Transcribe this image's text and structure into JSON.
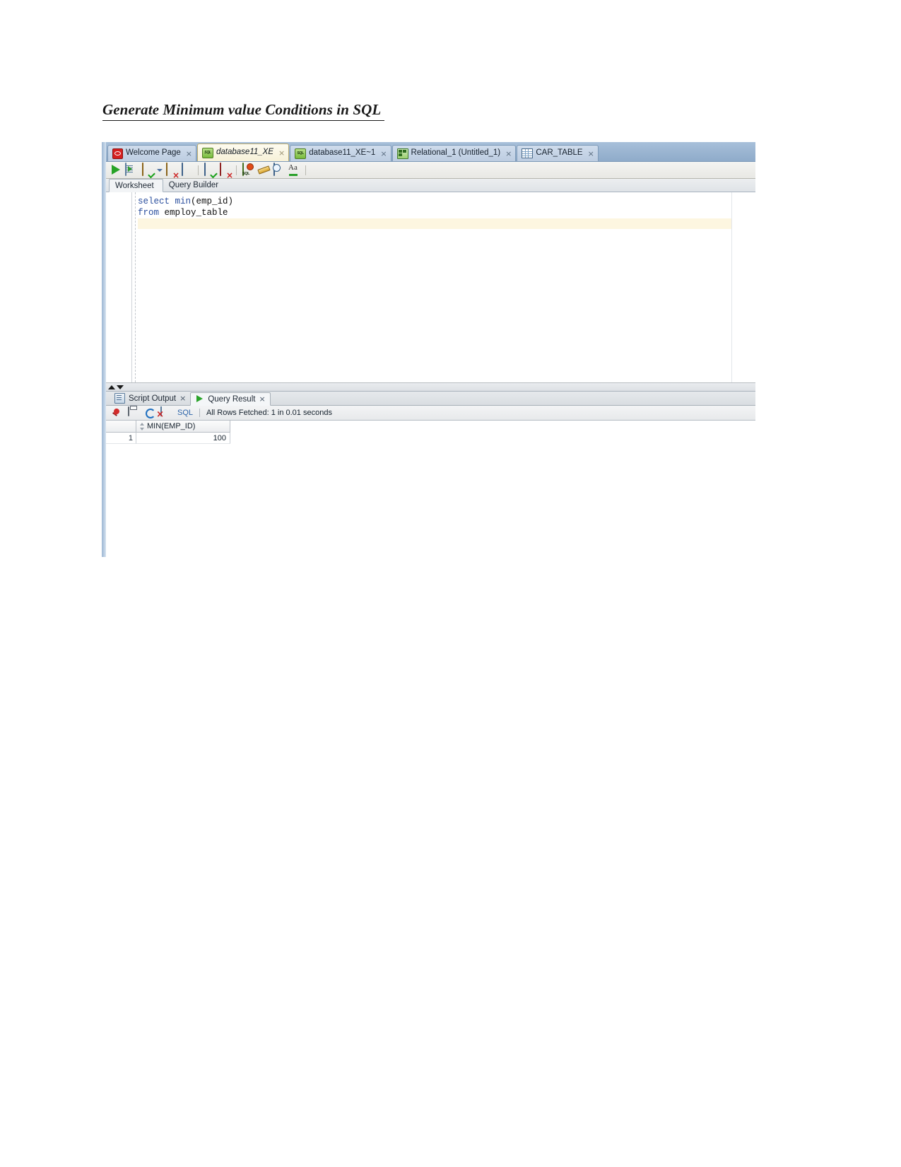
{
  "document": {
    "heading": "Generate Minimum value Conditions in SQL "
  },
  "editor_tabs": [
    {
      "label": "Welcome Page",
      "icon": "oracle-icon",
      "close": "×",
      "active": false
    },
    {
      "label": "database11_XE",
      "icon": "db-connection-icon",
      "close": "×",
      "active": true
    },
    {
      "label": "database11_XE~1",
      "icon": "db-connection-icon",
      "close": "×",
      "active": false
    },
    {
      "label": "Relational_1 (Untitled_1)",
      "icon": "data-model-icon",
      "close": "×",
      "active": false
    },
    {
      "label": "CAR_TABLE",
      "icon": "table-grid-icon",
      "close": "×",
      "active": false
    }
  ],
  "toolbar": {
    "buttons": [
      {
        "name": "run-statement-button",
        "icon": "green-play-icon"
      },
      {
        "name": "run-script-button",
        "icon": "run-script-icon"
      },
      {
        "name": "commit-button",
        "icon": "commit-icon"
      },
      {
        "name": "commit-dropdown-button",
        "icon": "chevron-down-icon"
      },
      {
        "name": "rollback-button",
        "icon": "rollback-icon"
      },
      {
        "name": "unshared-sql-worksheet-button",
        "icon": "explain-plan-icon"
      },
      {
        "name": "to-upper-case-button",
        "icon": "commit-check-icon"
      },
      {
        "name": "clear-button",
        "icon": "cancel-db-icon"
      },
      {
        "name": "sql-history-button",
        "icon": "sql-badge-icon"
      },
      {
        "name": "format-button",
        "icon": "pencil-icon"
      },
      {
        "name": "query-builder-button",
        "icon": "clock-icon"
      },
      {
        "name": "autotrace-button",
        "icon": "aa-icon"
      }
    ]
  },
  "worksheet_tabs": [
    {
      "label": "Worksheet",
      "active": true
    },
    {
      "label": "Query Builder",
      "active": false
    }
  ],
  "editor": {
    "code_lines": [
      {
        "keyword": "select ",
        "rest": "min(emp_id)"
      },
      {
        "keyword": "from ",
        "rest": "employ_table"
      }
    ],
    "line1_keyword": "select",
    "line1_func": " min",
    "line1_rest": "(emp_id)",
    "line2_keyword": "from",
    "line2_rest": " employ_table"
  },
  "result_tabs": [
    {
      "label": "Script Output",
      "icon": "script-output-icon",
      "close": "×",
      "active": false
    },
    {
      "label": "Query Result",
      "icon": "green-play-icon",
      "close": "×",
      "active": true
    }
  ],
  "results_toolbar": {
    "buttons": [
      {
        "name": "pin-button",
        "icon": "pin-icon"
      },
      {
        "name": "print-button",
        "icon": "print-icon"
      },
      {
        "name": "refresh-button",
        "icon": "refresh-icon"
      },
      {
        "name": "cancel-button",
        "icon": "cancel-icon"
      }
    ],
    "sql_label": "SQL",
    "status": "All Rows Fetched: 1 in 0.01 seconds"
  },
  "grid": {
    "columns": [
      "MIN(EMP_ID)"
    ],
    "rows": [
      {
        "num": "1",
        "values": [
          "100"
        ]
      }
    ]
  },
  "colors": {
    "tab_active_bg": "#f7f1d8",
    "tabstrip_bg": "#9cb6d2",
    "keyword_blue": "#2b4f9e",
    "current_line": "#fdf6e0",
    "accent_green": "#27a327",
    "sql_link": "#2b63a8"
  }
}
